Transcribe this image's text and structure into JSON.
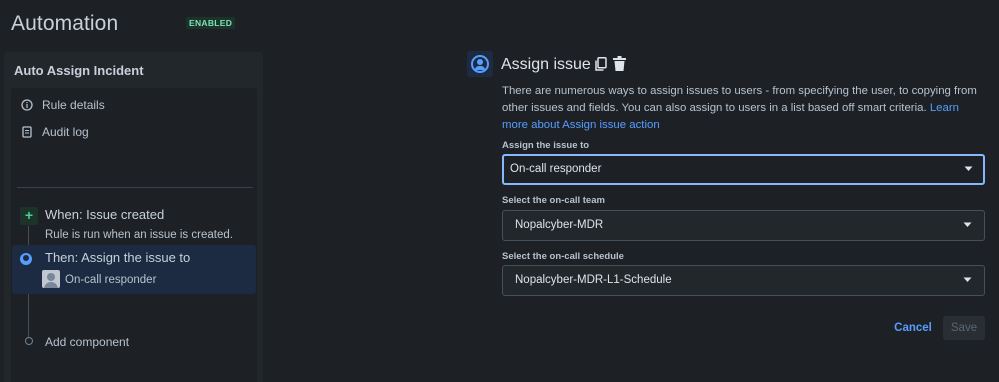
{
  "header": {
    "title": "Automation",
    "status_badge": "ENABLED"
  },
  "sidebar": {
    "rule_name": "Auto Assign Incident",
    "nav": [
      {
        "label": "Rule details",
        "icon": "info-icon"
      },
      {
        "label": "Audit log",
        "icon": "document-icon"
      }
    ],
    "trigger": {
      "title": "When: Issue created",
      "subtitle": "Rule is run when an issue is created.",
      "icon": "plus-icon"
    },
    "action": {
      "title": "Then: Assign the issue to",
      "assignee": "On-call responder",
      "icon": "user-circle-icon"
    },
    "add_component": "Add component"
  },
  "panel": {
    "title": "Assign issue",
    "description": "There are numerous ways to assign issues to users - from specifying the user, to copying from other issues and fields. You can also assign to users in a list based off smart criteria.",
    "link_text": "Learn more about Assign issue action",
    "fields": [
      {
        "label": "Assign the issue to",
        "value": "On-call responder"
      },
      {
        "label": "Select the on-call team",
        "value": "Nopalcyber-MDR"
      },
      {
        "label": "Select the on-call schedule",
        "value": "Nopalcyber-MDR-L1-Schedule"
      }
    ],
    "cancel_label": "Cancel",
    "save_label": "Save"
  },
  "colors": {
    "accent": "#579dff",
    "success": "#4bce97",
    "background": "#1d2125"
  }
}
